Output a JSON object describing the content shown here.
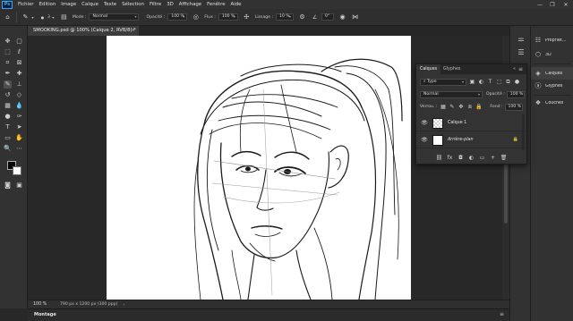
{
  "app": {
    "logo": "Ps"
  },
  "menubar": {
    "items": [
      "Fichier",
      "Edition",
      "Image",
      "Calque",
      "Texte",
      "Sélection",
      "Filtre",
      "3D",
      "Affichage",
      "Fenêtre",
      "Aide"
    ],
    "window_controls": [
      "—",
      "❐",
      "✕"
    ]
  },
  "options": {
    "brush_size": "3",
    "mode_label": "Mode :",
    "mode_value": "Normal",
    "opacity_label": "Opacité :",
    "opacity_value": "100 %",
    "flow_label": "Flux :",
    "flow_value": "100 %",
    "smoothing_label": "Lissage :",
    "smoothing_value": "10 %",
    "angle_value": "0°"
  },
  "document": {
    "tab_title": "SMOOKING.psd @ 100% (Calque 2, RVB/8) *",
    "close": "×"
  },
  "status": {
    "zoom": "100 %",
    "info": "790 px x 1200 px (300 ppp)",
    "caret": "›"
  },
  "bottom_panel": {
    "title": "Montage",
    "menu": "≡"
  },
  "right_panels": {
    "items": [
      {
        "icon": "properties-icon",
        "label": "Propriét..."
      },
      {
        "icon": "3d-icon",
        "label": "3D"
      },
      {
        "icon": "layers-icon",
        "label": "Calques"
      },
      {
        "icon": "glyphs-icon",
        "label": "Glyphes"
      },
      {
        "icon": "channels-icon",
        "label": "Couches"
      }
    ]
  },
  "layers_panel": {
    "tabs": [
      "Calques",
      "Glyphes"
    ],
    "active_tab": "Calques",
    "filter_label": "Type",
    "blend_mode": "Normal",
    "opacity_label": "Opacité :",
    "opacity_value": "100 %",
    "lock_label": "Verrou. :",
    "fill_label": "Fond :",
    "fill_value": "100 %",
    "layers": [
      {
        "name": "Calque 1",
        "visible": true,
        "locked": false,
        "selected": false
      },
      {
        "name": "Arrière-plan",
        "visible": true,
        "locked": true,
        "selected": false
      }
    ],
    "footer_icons": [
      "link-icon",
      "fx-icon",
      "mask-icon",
      "adjustment-icon",
      "group-icon",
      "new-layer-icon",
      "trash-icon"
    ],
    "footer_glyphs": [
      "⛓",
      "fx",
      "◘",
      "◐",
      "▭",
      "+",
      "🗑"
    ]
  },
  "colors": {
    "accent": "#31a8ff",
    "foreground_color": "#000000",
    "background_color": "#ffffff",
    "ui_dark": "#323232",
    "canvas": "#ffffff"
  }
}
